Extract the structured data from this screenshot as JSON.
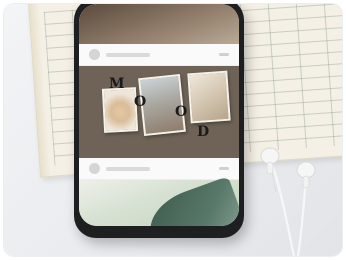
{
  "collage": {
    "letters": [
      "M",
      "O",
      "O",
      "D"
    ]
  },
  "colors": {
    "background": "#eceef0",
    "notebook_paper": "#f4f0e6",
    "phone_body": "#1e1f21",
    "collage_background": "#6e6356",
    "earphones": "#f7f7f7"
  }
}
